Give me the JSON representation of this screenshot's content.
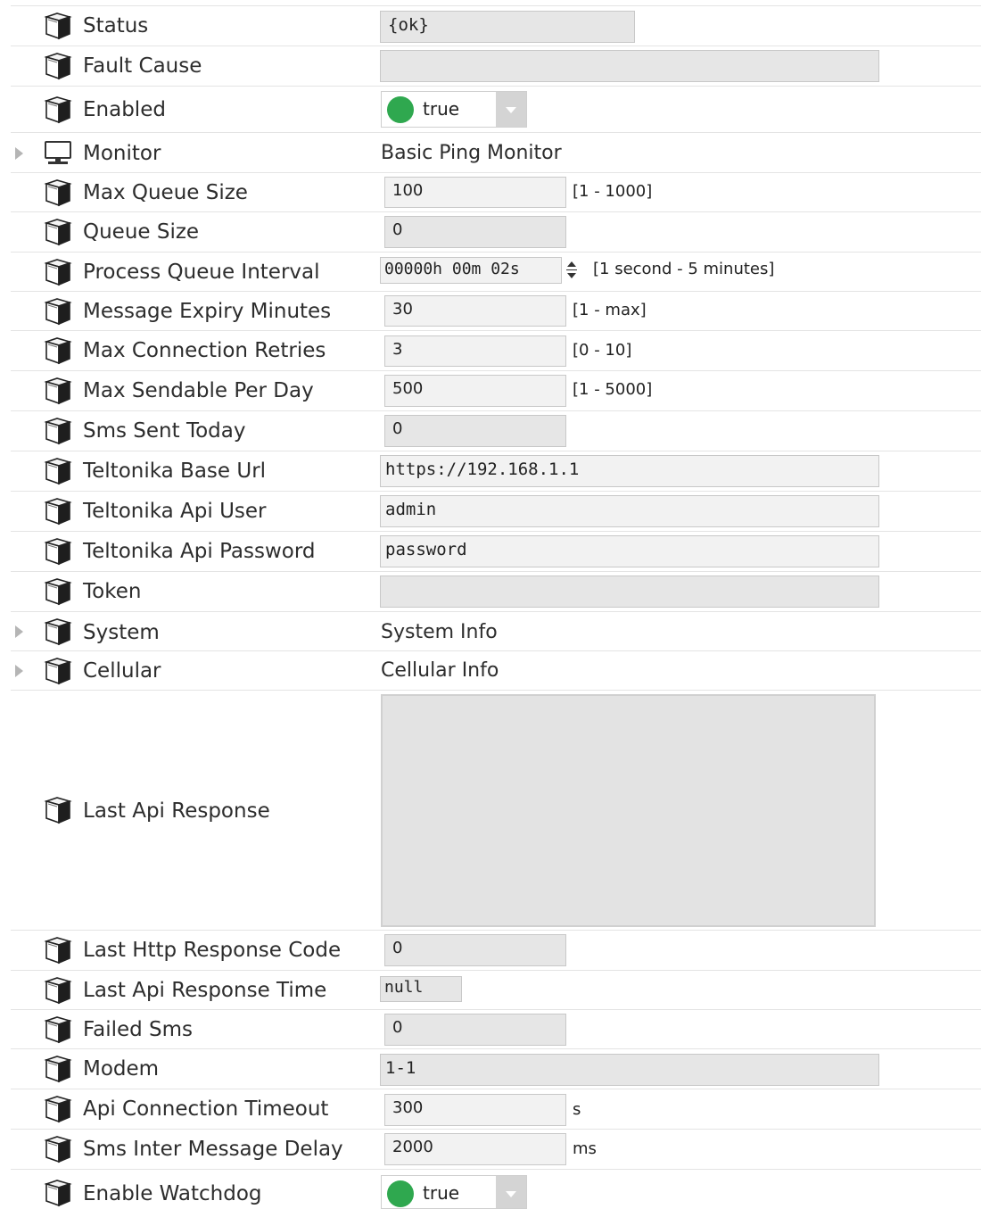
{
  "rows": {
    "status": {
      "label": "Status",
      "value": "{ok}"
    },
    "fault_cause": {
      "label": "Fault Cause",
      "value": ""
    },
    "enabled": {
      "label": "Enabled",
      "value": "true",
      "status_color": "#2fa84f"
    },
    "monitor": {
      "label": "Monitor",
      "value": "Basic Ping Monitor"
    },
    "max_queue_size": {
      "label": "Max Queue Size",
      "value": "100",
      "range": "[1 - 1000]"
    },
    "queue_size": {
      "label": "Queue Size",
      "value": "0"
    },
    "process_queue_interval": {
      "label": "Process Queue Interval",
      "value": "00000h 00m 02s",
      "range": "[1 second - 5 minutes]"
    },
    "message_expiry_minutes": {
      "label": "Message Expiry Minutes",
      "value": "30",
      "range": "[1 - max]"
    },
    "max_connection_retries": {
      "label": "Max Connection Retries",
      "value": "3",
      "range": "[0 - 10]"
    },
    "max_sendable_per_day": {
      "label": "Max Sendable Per Day",
      "value": "500",
      "range": "[1 - 5000]"
    },
    "sms_sent_today": {
      "label": "Sms Sent Today",
      "value": "0"
    },
    "teltonika_base_url": {
      "label": "Teltonika Base Url",
      "value": "https://192.168.1.1"
    },
    "teltonika_api_user": {
      "label": "Teltonika Api User",
      "value": "admin"
    },
    "teltonika_api_password": {
      "label": "Teltonika Api Password",
      "value": "password"
    },
    "token": {
      "label": "Token",
      "value": ""
    },
    "system": {
      "label": "System",
      "value": "System Info"
    },
    "cellular": {
      "label": "Cellular",
      "value": "Cellular Info"
    },
    "last_api_response": {
      "label": "Last Api Response",
      "value": ""
    },
    "last_http_response_code": {
      "label": "Last Http Response Code",
      "value": "0"
    },
    "last_api_response_time": {
      "label": "Last Api Response Time",
      "value": "null"
    },
    "failed_sms": {
      "label": "Failed Sms",
      "value": "0"
    },
    "modem": {
      "label": "Modem",
      "value": "1-1"
    },
    "api_connection_timeout": {
      "label": "Api Connection Timeout",
      "value": "300",
      "unit": "s"
    },
    "sms_inter_message_delay": {
      "label": "Sms Inter Message Delay",
      "value": "2000",
      "unit": "ms"
    },
    "enable_watchdog": {
      "label": "Enable Watchdog",
      "value": "true",
      "status_color": "#2fa84f"
    }
  },
  "icons": {
    "slot": "property-slot-icon",
    "monitor": "monitor-icon",
    "expand": "expand-triangle-icon",
    "dropdown": "chevron-down-icon",
    "spinner": "spinner-arrows-icon"
  }
}
